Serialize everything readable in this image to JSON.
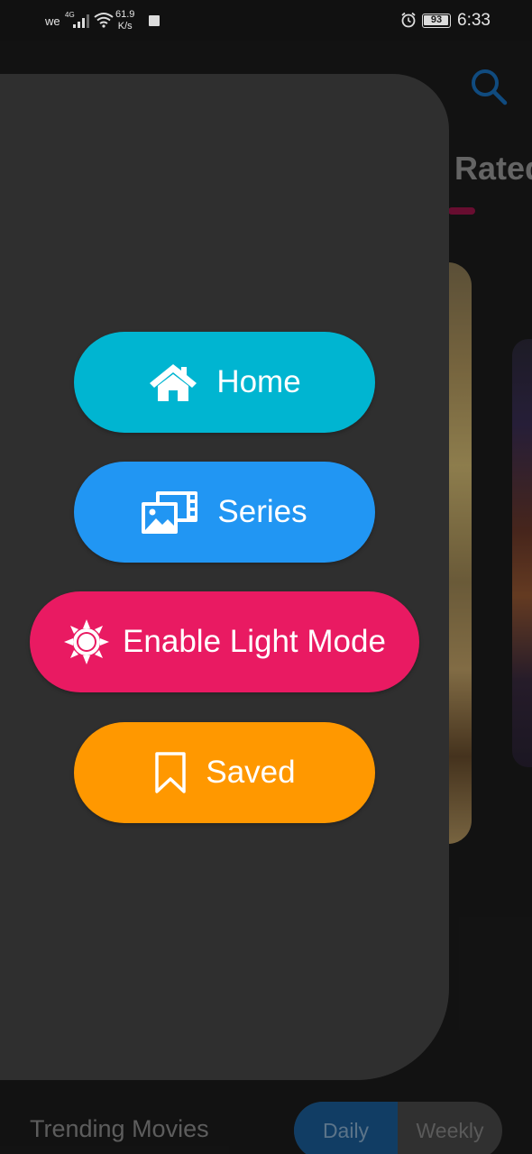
{
  "status_bar": {
    "carrier": "we",
    "network": "4G",
    "speed": "61.9",
    "speed_unit": "K/s",
    "battery": "93",
    "time": "6:33"
  },
  "background": {
    "tab_label": "Rated",
    "section_title": "Trending Movies",
    "period_options": [
      "Daily",
      "Weekly"
    ],
    "selected_period": "Daily"
  },
  "drawer": {
    "items": [
      {
        "label": "Home",
        "icon": "home-icon",
        "color": "#00b5d1"
      },
      {
        "label": "Series",
        "icon": "film-photo-icon",
        "color": "#2196f3"
      },
      {
        "label": "Enable Light Mode",
        "icon": "sun-icon",
        "color": "#e91a62"
      },
      {
        "label": "Saved",
        "icon": "bookmark-icon",
        "color": "#ff9800"
      }
    ]
  },
  "colors": {
    "drawer_background": "#2f2f2f",
    "app_background": "#1d1d1d",
    "tab_indicator": "#a0154a",
    "search_icon": "#1a73c4"
  }
}
